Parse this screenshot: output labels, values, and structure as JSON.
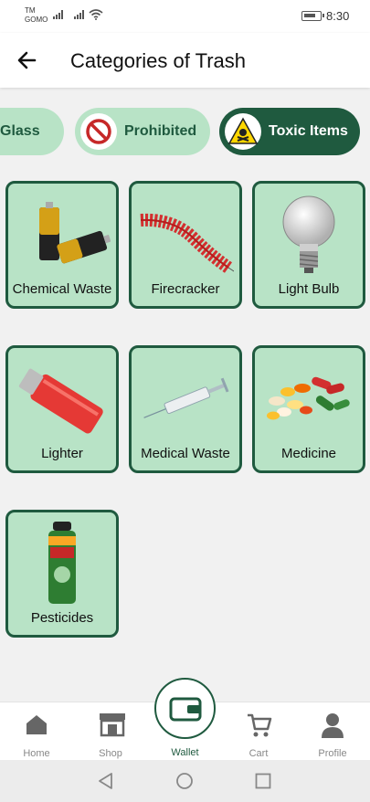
{
  "status_bar": {
    "carrier_line1": "TM",
    "carrier_line2": "GOMO",
    "time": "8:30"
  },
  "header": {
    "title": "Categories of Trash",
    "back_icon": "arrow-left-icon"
  },
  "chips": [
    {
      "label": "Glass",
      "icon": "glass-icon",
      "selected": false
    },
    {
      "label": "Prohibited",
      "icon": "prohibited-icon",
      "selected": false
    },
    {
      "label": "Toxic Items",
      "icon": "toxic-warning-icon",
      "selected": true
    }
  ],
  "items": [
    {
      "label": "Chemical Waste",
      "icon": "batteries-icon"
    },
    {
      "label": "Firecracker",
      "icon": "firecracker-icon"
    },
    {
      "label": "Light Bulb",
      "icon": "light-bulb-icon"
    },
    {
      "label": "Lighter",
      "icon": "lighter-icon"
    },
    {
      "label": "Medical Waste",
      "icon": "syringe-icon"
    },
    {
      "label": "Medicine",
      "icon": "pills-icon"
    },
    {
      "label": "Pesticides",
      "icon": "pesticide-can-icon"
    }
  ],
  "bottom_nav": {
    "home": "Home",
    "shop": "Shop",
    "wallet": "Wallet",
    "cart": "Cart",
    "profile": "Profile",
    "active": "Wallet"
  },
  "colors": {
    "accent_dark": "#1f5a3f",
    "card_bg": "#b8e3c6",
    "page_bg": "#f1f1f1"
  }
}
